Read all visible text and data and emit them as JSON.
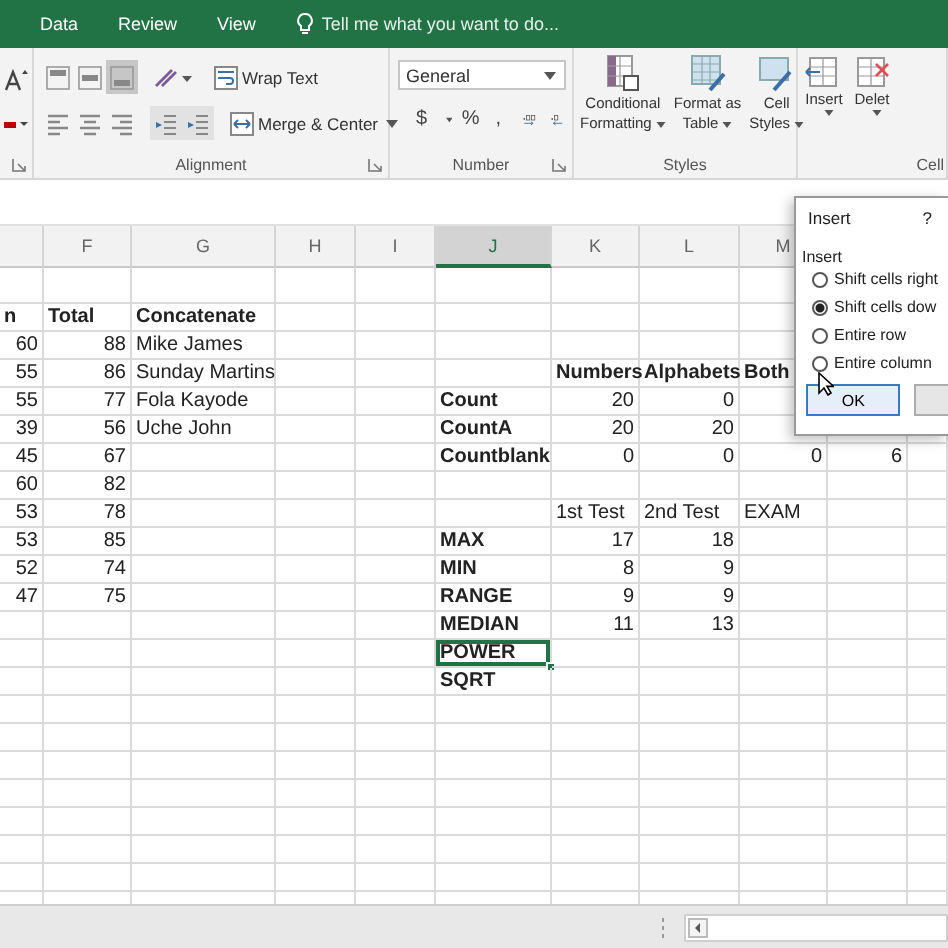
{
  "ribbon_tabs": [
    {
      "label": "Data",
      "selected": false
    },
    {
      "label": "Review",
      "selected": false
    },
    {
      "label": "View",
      "selected": false
    }
  ],
  "tell_me": "Tell me what you want to do...",
  "ribbon": {
    "alignment": {
      "vertical": [
        {
          "selected": false
        },
        {
          "selected": false
        },
        {
          "selected": true
        }
      ],
      "horizontal": [
        {
          "selected": false
        },
        {
          "selected": false
        },
        {
          "selected": false
        }
      ],
      "wrap_text": "Wrap Text",
      "merge": "Merge & Center",
      "label": "Alignment"
    },
    "number": {
      "format": "General",
      "symbols": [
        "$",
        "%",
        ","
      ],
      "label": "Number"
    },
    "styles": {
      "buttons": [
        {
          "lines": [
            "Conditional",
            "Formatting"
          ]
        },
        {
          "lines": [
            "Format as",
            "Table"
          ]
        },
        {
          "lines": [
            "Cell",
            "Styles"
          ]
        }
      ],
      "label": "Styles"
    },
    "cells": {
      "buttons": [
        "Insert",
        "Delet"
      ],
      "label": "Cell"
    }
  },
  "grid": {
    "column_headers": [
      "F",
      "G",
      "H",
      "I",
      "J",
      "K",
      "L",
      "M"
    ],
    "rows": [
      {
        "e": {
          "text": "n",
          "bold": true
        },
        "f": {
          "text": "Total",
          "bold": true
        },
        "g": {
          "text": "Concatenate",
          "bold": true
        }
      },
      {
        "e": "60",
        "f": "88",
        "g": "Mike James"
      },
      {
        "e": "55",
        "f": "86",
        "g": "Sunday Martins",
        "k": {
          "text": "Numbers",
          "bold": true
        },
        "l": {
          "text": "Alphabets",
          "bold": true
        },
        "m": {
          "text": "Both",
          "bold": true
        }
      },
      {
        "e": "55",
        "f": "77",
        "g": "Fola Kayode",
        "j": {
          "text": "Count",
          "bold": true
        },
        "k": "20",
        "l": "0"
      },
      {
        "e": "39",
        "f": "56",
        "g": "Uche John",
        "j": {
          "text": "CountA",
          "bold": true
        },
        "k": "20",
        "l": "20"
      },
      {
        "e": "45",
        "f": "67",
        "j": {
          "text": "Countblank",
          "bold": true
        },
        "k": "0",
        "l": "0",
        "m": "0",
        "n": "6"
      },
      {
        "e": "60",
        "f": "82"
      },
      {
        "e": "53",
        "f": "78",
        "k": "1st Test",
        "l": "2nd Test",
        "m": "EXAM"
      },
      {
        "e": "53",
        "f": "85",
        "j": {
          "text": "MAX",
          "bold": true
        },
        "k": "17",
        "l": "18"
      },
      {
        "e": "52",
        "f": "74",
        "j": {
          "text": "MIN",
          "bold": true
        },
        "k": "8",
        "l": "9"
      },
      {
        "e": "47",
        "f": "75",
        "j": {
          "text": "RANGE",
          "bold": true
        },
        "k": "9",
        "l": "9"
      },
      {
        "j": {
          "text": "MEDIAN",
          "bold": true
        },
        "k": "11",
        "l": "13"
      },
      {
        "j": {
          "text": "POWER",
          "bold": true,
          "selected": true
        }
      },
      {
        "j": {
          "text": "SQRT",
          "bold": true
        }
      }
    ]
  },
  "dialog": {
    "title": "Insert",
    "help": "?",
    "group": "Insert",
    "options": [
      {
        "label": "Shift cells right",
        "selected": false
      },
      {
        "label": "Shift cells dow",
        "selected": true
      },
      {
        "label": "Entire row",
        "selected": false
      },
      {
        "label": "Entire column",
        "selected": false
      }
    ],
    "ok": "OK"
  }
}
